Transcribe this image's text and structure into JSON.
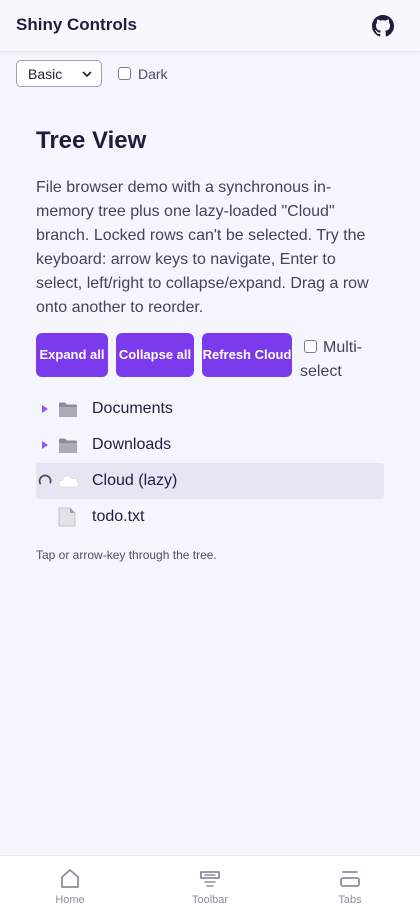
{
  "app": {
    "title": "Shiny Controls",
    "github_icon": "github-icon"
  },
  "controls": {
    "theme_select_value": "Basic",
    "dark_label": "Dark",
    "dark_checked": false
  },
  "page": {
    "title": "Tree View",
    "description": "File browser demo with a synchronous in-memory tree plus one lazy-loaded \"Cloud\" branch. Locked rows can't be selected. Try the keyboard: arrow keys to navigate, Enter to select, left/right to collapse/expand. Drag a row onto another to reorder."
  },
  "actions": {
    "expand_all": "Expand all",
    "collapse_all": "Collapse all",
    "refresh_cloud": "Refresh Cloud",
    "multi_select_label": "Multi-select",
    "multi_select_checked": false
  },
  "tree": {
    "rows": [
      {
        "label": "Documents",
        "icon": "folder-icon",
        "toggle": "caret-right-icon"
      },
      {
        "label": "Downloads",
        "icon": "folder-icon",
        "toggle": "caret-right-icon"
      },
      {
        "label": "Cloud (lazy)",
        "icon": "cloud-icon",
        "toggle": "loading-spinner-icon",
        "selected": true
      },
      {
        "label": "todo.txt",
        "icon": "file-icon"
      }
    ]
  },
  "status": "Tap or arrow-key through the tree.",
  "nav": {
    "items": [
      {
        "label": "Home",
        "icon": "home-icon"
      },
      {
        "label": "Toolbar",
        "icon": "toolbar-icon"
      },
      {
        "label": "Tabs",
        "icon": "tabs-icon"
      }
    ]
  },
  "colors": {
    "accent": "#7c3aed",
    "caret": "#8b5cf6",
    "selected_row": "#e4e6f1",
    "background": "#f5f6fd"
  }
}
